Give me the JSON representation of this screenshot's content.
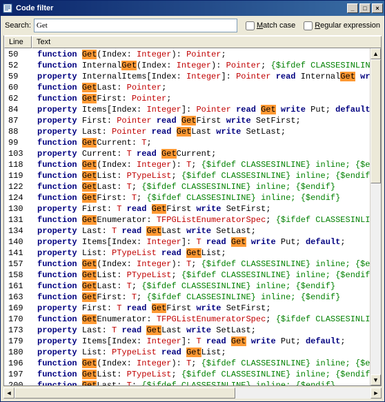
{
  "window": {
    "title": "Code filter"
  },
  "search": {
    "label": "Search:",
    "value": "Get",
    "matchCaseLabel": "Match case",
    "regexLabel": "Regular expression",
    "matchCase": false,
    "regex": false
  },
  "columns": {
    "line": "Line",
    "text": "Text"
  },
  "highlight": "Get",
  "rows": [
    {
      "line": 50,
      "tokens": [
        {
          "t": "kw-func",
          "v": "function "
        },
        {
          "t": "hl",
          "v": "Get"
        },
        {
          "t": "ident",
          "v": "(Index: "
        },
        {
          "t": "typ",
          "v": "Integer"
        },
        {
          "t": "ident",
          "v": "): "
        },
        {
          "t": "typ",
          "v": "Pointer"
        },
        {
          "t": "ident",
          "v": ";"
        }
      ]
    },
    {
      "line": 52,
      "tokens": [
        {
          "t": "kw-func",
          "v": "function  "
        },
        {
          "t": "ident",
          "v": "Internal"
        },
        {
          "t": "hl",
          "v": "Get"
        },
        {
          "t": "ident",
          "v": "(Index: "
        },
        {
          "t": "typ",
          "v": "Integer"
        },
        {
          "t": "ident",
          "v": "): "
        },
        {
          "t": "typ",
          "v": "Pointer"
        },
        {
          "t": "ident",
          "v": "; "
        },
        {
          "t": "cmt",
          "v": "{$ifdef CLASSESINLINE} in..."
        }
      ]
    },
    {
      "line": 59,
      "tokens": [
        {
          "t": "kw-prop",
          "v": "property "
        },
        {
          "t": "ident",
          "v": "InternalItems[Index: "
        },
        {
          "t": "typ",
          "v": "Integer"
        },
        {
          "t": "ident",
          "v": "]: "
        },
        {
          "t": "typ",
          "v": "Pointer"
        },
        {
          "t": "ident",
          "v": " "
        },
        {
          "t": "kw-read",
          "v": "read "
        },
        {
          "t": "ident",
          "v": "Internal"
        },
        {
          "t": "hl",
          "v": "Get"
        },
        {
          "t": "ident",
          "v": " "
        },
        {
          "t": "kw-write",
          "v": "write "
        },
        {
          "t": "ident",
          "v": "In..."
        }
      ]
    },
    {
      "line": 60,
      "tokens": [
        {
          "t": "kw-func",
          "v": "function "
        },
        {
          "t": "hl",
          "v": "Get"
        },
        {
          "t": "ident",
          "v": "Last: "
        },
        {
          "t": "typ",
          "v": "Pointer"
        },
        {
          "t": "ident",
          "v": ";"
        }
      ]
    },
    {
      "line": 62,
      "tokens": [
        {
          "t": "kw-func",
          "v": "function "
        },
        {
          "t": "hl",
          "v": "Get"
        },
        {
          "t": "ident",
          "v": "First: "
        },
        {
          "t": "typ",
          "v": "Pointer"
        },
        {
          "t": "ident",
          "v": ";"
        }
      ]
    },
    {
      "line": 84,
      "tokens": [
        {
          "t": "kw-prop",
          "v": "property "
        },
        {
          "t": "ident",
          "v": "Items[Index: "
        },
        {
          "t": "typ",
          "v": "Integer"
        },
        {
          "t": "ident",
          "v": "]: "
        },
        {
          "t": "typ",
          "v": "Pointer"
        },
        {
          "t": "ident",
          "v": " "
        },
        {
          "t": "kw-read",
          "v": "read "
        },
        {
          "t": "hl",
          "v": "Get"
        },
        {
          "t": "ident",
          "v": " "
        },
        {
          "t": "kw-write",
          "v": "write "
        },
        {
          "t": "ident",
          "v": "Put; "
        },
        {
          "t": "kw-default",
          "v": "default"
        },
        {
          "t": "ident",
          "v": ";"
        }
      ]
    },
    {
      "line": 87,
      "tokens": [
        {
          "t": "kw-prop",
          "v": "property "
        },
        {
          "t": "ident",
          "v": "First: "
        },
        {
          "t": "typ",
          "v": "Pointer"
        },
        {
          "t": "ident",
          "v": " "
        },
        {
          "t": "kw-read",
          "v": "read "
        },
        {
          "t": "hl",
          "v": "Get"
        },
        {
          "t": "ident",
          "v": "First "
        },
        {
          "t": "kw-write",
          "v": "write "
        },
        {
          "t": "ident",
          "v": "SetFirst;"
        }
      ]
    },
    {
      "line": 88,
      "tokens": [
        {
          "t": "kw-prop",
          "v": "property "
        },
        {
          "t": "ident",
          "v": "Last: "
        },
        {
          "t": "typ",
          "v": "Pointer"
        },
        {
          "t": "ident",
          "v": " "
        },
        {
          "t": "kw-read",
          "v": "read "
        },
        {
          "t": "hl",
          "v": "Get"
        },
        {
          "t": "ident",
          "v": "Last "
        },
        {
          "t": "kw-write",
          "v": "write "
        },
        {
          "t": "ident",
          "v": "SetLast;"
        }
      ]
    },
    {
      "line": 99,
      "tokens": [
        {
          "t": "kw-func",
          "v": "function "
        },
        {
          "t": "hl",
          "v": "Get"
        },
        {
          "t": "ident",
          "v": "Current: "
        },
        {
          "t": "typ",
          "v": "T"
        },
        {
          "t": "ident",
          "v": ";"
        }
      ]
    },
    {
      "line": 103,
      "tokens": [
        {
          "t": "kw-prop",
          "v": "property "
        },
        {
          "t": "ident",
          "v": "Current: "
        },
        {
          "t": "typ",
          "v": "T"
        },
        {
          "t": "ident",
          "v": " "
        },
        {
          "t": "kw-read",
          "v": "read "
        },
        {
          "t": "hl",
          "v": "Get"
        },
        {
          "t": "ident",
          "v": "Current;"
        }
      ]
    },
    {
      "line": 118,
      "tokens": [
        {
          "t": "kw-func",
          "v": "function  "
        },
        {
          "t": "hl",
          "v": "Get"
        },
        {
          "t": "ident",
          "v": "(Index: "
        },
        {
          "t": "typ",
          "v": "Integer"
        },
        {
          "t": "ident",
          "v": "): "
        },
        {
          "t": "typ",
          "v": "T"
        },
        {
          "t": "ident",
          "v": "; "
        },
        {
          "t": "cmt",
          "v": "{$ifdef CLASSESINLINE} inline; {$endif}"
        }
      ]
    },
    {
      "line": 119,
      "tokens": [
        {
          "t": "kw-func",
          "v": "function  "
        },
        {
          "t": "hl",
          "v": "Get"
        },
        {
          "t": "ident",
          "v": "List: "
        },
        {
          "t": "typ",
          "v": "PTypeList"
        },
        {
          "t": "ident",
          "v": "; "
        },
        {
          "t": "cmt",
          "v": "{$ifdef CLASSESINLINE} inline; {$endif}"
        }
      ]
    },
    {
      "line": 122,
      "tokens": [
        {
          "t": "kw-func",
          "v": "function "
        },
        {
          "t": "hl",
          "v": "Get"
        },
        {
          "t": "ident",
          "v": "Last: "
        },
        {
          "t": "typ",
          "v": "T"
        },
        {
          "t": "ident",
          "v": "; "
        },
        {
          "t": "cmt",
          "v": "{$ifdef CLASSESINLINE} inline; {$endif}"
        }
      ]
    },
    {
      "line": 124,
      "tokens": [
        {
          "t": "kw-func",
          "v": "function "
        },
        {
          "t": "hl",
          "v": "Get"
        },
        {
          "t": "ident",
          "v": "First: "
        },
        {
          "t": "typ",
          "v": "T"
        },
        {
          "t": "ident",
          "v": "; "
        },
        {
          "t": "cmt",
          "v": "{$ifdef CLASSESINLINE} inline; {$endif}"
        }
      ]
    },
    {
      "line": 130,
      "tokens": [
        {
          "t": "kw-prop",
          "v": "property "
        },
        {
          "t": "ident",
          "v": "First: "
        },
        {
          "t": "typ",
          "v": "T"
        },
        {
          "t": "ident",
          "v": " "
        },
        {
          "t": "kw-read",
          "v": "read "
        },
        {
          "t": "hl",
          "v": "Get"
        },
        {
          "t": "ident",
          "v": "First "
        },
        {
          "t": "kw-write",
          "v": "write "
        },
        {
          "t": "ident",
          "v": "SetFirst;"
        }
      ]
    },
    {
      "line": 131,
      "tokens": [
        {
          "t": "kw-func",
          "v": "function "
        },
        {
          "t": "hl",
          "v": "Get"
        },
        {
          "t": "ident",
          "v": "Enumerator: "
        },
        {
          "t": "typ",
          "v": "TFPGListEnumeratorSpec"
        },
        {
          "t": "ident",
          "v": "; "
        },
        {
          "t": "cmt",
          "v": "{$ifdef CLASSESINLINE} in..."
        }
      ]
    },
    {
      "line": 134,
      "tokens": [
        {
          "t": "kw-prop",
          "v": "property "
        },
        {
          "t": "ident",
          "v": "Last: "
        },
        {
          "t": "typ",
          "v": "T"
        },
        {
          "t": "ident",
          "v": " "
        },
        {
          "t": "kw-read",
          "v": "read "
        },
        {
          "t": "hl",
          "v": "Get"
        },
        {
          "t": "ident",
          "v": "Last "
        },
        {
          "t": "kw-write",
          "v": "write "
        },
        {
          "t": "ident",
          "v": "SetLast;"
        }
      ]
    },
    {
      "line": 140,
      "tokens": [
        {
          "t": "kw-prop",
          "v": "property "
        },
        {
          "t": "ident",
          "v": "Items[Index: "
        },
        {
          "t": "typ",
          "v": "Integer"
        },
        {
          "t": "ident",
          "v": "]: "
        },
        {
          "t": "typ",
          "v": "T"
        },
        {
          "t": "ident",
          "v": " "
        },
        {
          "t": "kw-read",
          "v": "read "
        },
        {
          "t": "hl",
          "v": "Get"
        },
        {
          "t": "ident",
          "v": " "
        },
        {
          "t": "kw-write",
          "v": "write "
        },
        {
          "t": "ident",
          "v": "Put; "
        },
        {
          "t": "kw-default",
          "v": "default"
        },
        {
          "t": "ident",
          "v": ";"
        }
      ]
    },
    {
      "line": 141,
      "tokens": [
        {
          "t": "kw-prop",
          "v": "property "
        },
        {
          "t": "ident",
          "v": "List: "
        },
        {
          "t": "typ",
          "v": "PTypeList"
        },
        {
          "t": "ident",
          "v": " "
        },
        {
          "t": "kw-read",
          "v": "read "
        },
        {
          "t": "hl",
          "v": "Get"
        },
        {
          "t": "ident",
          "v": "List;"
        }
      ]
    },
    {
      "line": 157,
      "tokens": [
        {
          "t": "kw-func",
          "v": "function  "
        },
        {
          "t": "hl",
          "v": "Get"
        },
        {
          "t": "ident",
          "v": "(Index: "
        },
        {
          "t": "typ",
          "v": "Integer"
        },
        {
          "t": "ident",
          "v": "): "
        },
        {
          "t": "typ",
          "v": "T"
        },
        {
          "t": "ident",
          "v": "; "
        },
        {
          "t": "cmt",
          "v": "{$ifdef CLASSESINLINE} inline; {$endif}"
        }
      ]
    },
    {
      "line": 158,
      "tokens": [
        {
          "t": "kw-func",
          "v": "function  "
        },
        {
          "t": "hl",
          "v": "Get"
        },
        {
          "t": "ident",
          "v": "List: "
        },
        {
          "t": "typ",
          "v": "PTypeList"
        },
        {
          "t": "ident",
          "v": "; "
        },
        {
          "t": "cmt",
          "v": "{$ifdef CLASSESINLINE} inline; {$endif}"
        }
      ]
    },
    {
      "line": 161,
      "tokens": [
        {
          "t": "kw-func",
          "v": "function "
        },
        {
          "t": "hl",
          "v": "Get"
        },
        {
          "t": "ident",
          "v": "Last: "
        },
        {
          "t": "typ",
          "v": "T"
        },
        {
          "t": "ident",
          "v": "; "
        },
        {
          "t": "cmt",
          "v": "{$ifdef CLASSESINLINE} inline; {$endif}"
        }
      ]
    },
    {
      "line": 163,
      "tokens": [
        {
          "t": "kw-func",
          "v": "function "
        },
        {
          "t": "hl",
          "v": "Get"
        },
        {
          "t": "ident",
          "v": "First: "
        },
        {
          "t": "typ",
          "v": "T"
        },
        {
          "t": "ident",
          "v": "; "
        },
        {
          "t": "cmt",
          "v": "{$ifdef CLASSESINLINE} inline; {$endif}"
        }
      ]
    },
    {
      "line": 169,
      "tokens": [
        {
          "t": "kw-prop",
          "v": "property "
        },
        {
          "t": "ident",
          "v": "First: "
        },
        {
          "t": "typ",
          "v": "T"
        },
        {
          "t": "ident",
          "v": " "
        },
        {
          "t": "kw-read",
          "v": "read "
        },
        {
          "t": "hl",
          "v": "Get"
        },
        {
          "t": "ident",
          "v": "First "
        },
        {
          "t": "kw-write",
          "v": "write "
        },
        {
          "t": "ident",
          "v": "SetFirst;"
        }
      ]
    },
    {
      "line": 170,
      "tokens": [
        {
          "t": "kw-func",
          "v": "function "
        },
        {
          "t": "hl",
          "v": "Get"
        },
        {
          "t": "ident",
          "v": "Enumerator: "
        },
        {
          "t": "typ",
          "v": "TFPGListEnumeratorSpec"
        },
        {
          "t": "ident",
          "v": "; "
        },
        {
          "t": "cmt",
          "v": "{$ifdef CLASSESINLINE} in..."
        }
      ]
    },
    {
      "line": 173,
      "tokens": [
        {
          "t": "kw-prop",
          "v": "property "
        },
        {
          "t": "ident",
          "v": "Last: "
        },
        {
          "t": "typ",
          "v": "T"
        },
        {
          "t": "ident",
          "v": " "
        },
        {
          "t": "kw-read",
          "v": "read "
        },
        {
          "t": "hl",
          "v": "Get"
        },
        {
          "t": "ident",
          "v": "Last "
        },
        {
          "t": "kw-write",
          "v": "write "
        },
        {
          "t": "ident",
          "v": "SetLast;"
        }
      ]
    },
    {
      "line": 179,
      "tokens": [
        {
          "t": "kw-prop",
          "v": "property "
        },
        {
          "t": "ident",
          "v": "Items[Index: "
        },
        {
          "t": "typ",
          "v": "Integer"
        },
        {
          "t": "ident",
          "v": "]: "
        },
        {
          "t": "typ",
          "v": "T"
        },
        {
          "t": "ident",
          "v": " "
        },
        {
          "t": "kw-read",
          "v": "read "
        },
        {
          "t": "hl",
          "v": "Get"
        },
        {
          "t": "ident",
          "v": " "
        },
        {
          "t": "kw-write",
          "v": "write "
        },
        {
          "t": "ident",
          "v": "Put; "
        },
        {
          "t": "kw-default",
          "v": "default"
        },
        {
          "t": "ident",
          "v": ";"
        }
      ]
    },
    {
      "line": 180,
      "tokens": [
        {
          "t": "kw-prop",
          "v": "property "
        },
        {
          "t": "ident",
          "v": "List: "
        },
        {
          "t": "typ",
          "v": "PTypeList"
        },
        {
          "t": "ident",
          "v": " "
        },
        {
          "t": "kw-read",
          "v": "read "
        },
        {
          "t": "hl",
          "v": "Get"
        },
        {
          "t": "ident",
          "v": "List;"
        }
      ]
    },
    {
      "line": 196,
      "tokens": [
        {
          "t": "kw-func",
          "v": "function  "
        },
        {
          "t": "hl",
          "v": "Get"
        },
        {
          "t": "ident",
          "v": "(Index: "
        },
        {
          "t": "typ",
          "v": "Integer"
        },
        {
          "t": "ident",
          "v": "): "
        },
        {
          "t": "typ",
          "v": "T"
        },
        {
          "t": "ident",
          "v": "; "
        },
        {
          "t": "cmt",
          "v": "{$ifdef CLASSESINLINE} inline; {$endif}"
        }
      ]
    },
    {
      "line": 197,
      "tokens": [
        {
          "t": "kw-func",
          "v": "function  "
        },
        {
          "t": "hl",
          "v": "Get"
        },
        {
          "t": "ident",
          "v": "List: "
        },
        {
          "t": "typ",
          "v": "PTypeList"
        },
        {
          "t": "ident",
          "v": "; "
        },
        {
          "t": "cmt",
          "v": "{$ifdef CLASSESINLINE} inline; {$endif}"
        }
      ]
    },
    {
      "line": 200,
      "tokens": [
        {
          "t": "kw-func",
          "v": "function "
        },
        {
          "t": "hl",
          "v": "Get"
        },
        {
          "t": "ident",
          "v": "Last: "
        },
        {
          "t": "typ",
          "v": "T"
        },
        {
          "t": "ident",
          "v": "; "
        },
        {
          "t": "cmt",
          "v": "{$ifdef CLASSESINLINE} inline; {$endif}"
        }
      ]
    }
  ]
}
